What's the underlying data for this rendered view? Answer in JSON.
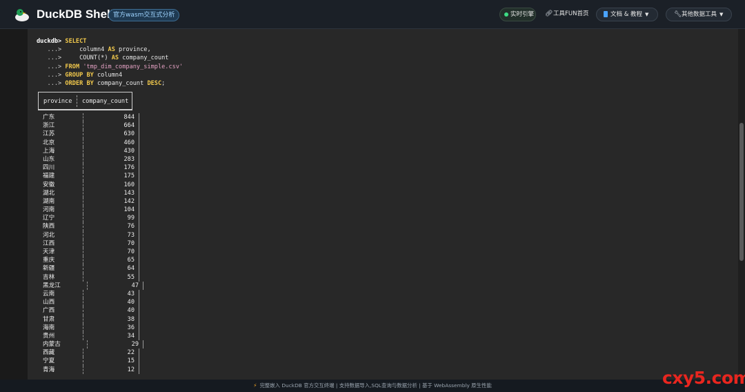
{
  "header": {
    "title": "DuckDB Shell",
    "subtitle": "官方wasm交互式分析",
    "nav": {
      "live": "实时引擎",
      "home_link": "工具FUN首页",
      "docs": "文档 & 教程",
      "tools": "其他数据工具"
    }
  },
  "terminal": {
    "prompt": "duckdb>",
    "continuation": "...>",
    "query_lines": [
      "SELECT",
      "    column4 AS province,",
      "    COUNT(*) AS company_count",
      "FROM 'tmp_dim_company_simple.csv'",
      "GROUP BY column4",
      "ORDER BY company_count DESC;"
    ],
    "result": {
      "columns": [
        "province",
        "company_count"
      ],
      "rows": [
        [
          "广东",
          "844"
        ],
        [
          "浙江",
          "664"
        ],
        [
          "江苏",
          "630"
        ],
        [
          "北京",
          "460"
        ],
        [
          "上海",
          "430"
        ],
        [
          "山东",
          "283"
        ],
        [
          "四川",
          "176"
        ],
        [
          "福建",
          "175"
        ],
        [
          "安徽",
          "160"
        ],
        [
          "湖北",
          "143"
        ],
        [
          "湖南",
          "142"
        ],
        [
          "河南",
          "104"
        ],
        [
          "辽宁",
          "99"
        ],
        [
          "陕西",
          "76"
        ],
        [
          "河北",
          "73"
        ],
        [
          "江西",
          "70"
        ],
        [
          "天津",
          "70"
        ],
        [
          "重庆",
          "65"
        ],
        [
          "新疆",
          "64"
        ],
        [
          "吉林",
          "55"
        ],
        [
          "黑龙江",
          "47"
        ],
        [
          "云南",
          "43"
        ],
        [
          "山西",
          "40"
        ],
        [
          "广西",
          "40"
        ],
        [
          "甘肃",
          "38"
        ],
        [
          "海南",
          "36"
        ],
        [
          "贵州",
          "34"
        ],
        [
          "内蒙古",
          "29"
        ],
        [
          "西藏",
          "22"
        ],
        [
          "宁夏",
          "15"
        ],
        [
          "青海",
          "12"
        ]
      ]
    }
  },
  "footer": {
    "text": "完整嵌入 DuckDB 官方交互终端 | 支持数据导入,SQL查询与数据分析 | 基于 WebAssembly 原生性能"
  },
  "watermark": "cxy5.com",
  "colors": {
    "keyword": "#f2c94c",
    "string": "#e5a2c4",
    "live_dot": "#3ddc84",
    "watermark": "#e8261f"
  }
}
